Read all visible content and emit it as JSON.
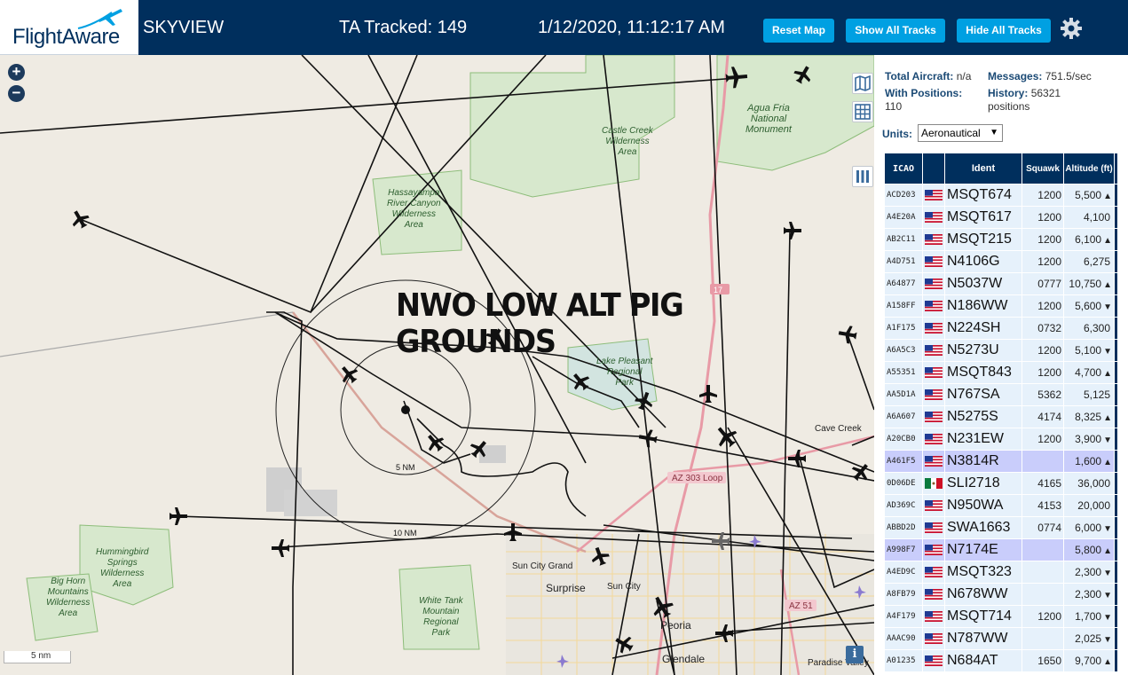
{
  "header": {
    "logo_text": "FlightAware",
    "app_name": "SKYVIEW",
    "tracked": "TA Tracked: 149",
    "timestamp": "1/12/2020, 11:12:17 AM",
    "buttons": {
      "reset": "Reset Map",
      "show": "Show All Tracks",
      "hide": "Hide All Tracks"
    },
    "settings_icon": "gear-icon"
  },
  "map": {
    "zoom_in": "+",
    "zoom_out": "−",
    "banner": "NWO LOW ALT PIG GROUNDS",
    "scale_label": "5 nm",
    "info_label": "i",
    "range_ring_labels": [
      "5 NM",
      "10 NM"
    ],
    "highway_label": "17",
    "route_label": "AZ 303 Loop",
    "route_label_2": "AZ 51",
    "regions": [
      {
        "text": "Agua Fria\nNational\nMonument"
      },
      {
        "text": "Castle Creek\nWilderness\nArea"
      },
      {
        "text": "Hassayampa\nRiver Canyon\nWilderness\nArea"
      },
      {
        "text": "Lake Pleasant\nRegional\nPark"
      },
      {
        "text": "Hummingbird\nSprings\nWilderness\nArea"
      },
      {
        "text": "Big Horn\nMountains\nWilderness\nArea"
      },
      {
        "text": "White Tank\nMountain\nRegional\nPark"
      }
    ],
    "cities": [
      "Cave Creek",
      "Sun City Grand",
      "Surprise",
      "Sun City",
      "Peoria",
      "Glendale",
      "Paradise Valley"
    ]
  },
  "sidebar": {
    "total_aircraft_label": "Total Aircraft:",
    "total_aircraft_value": "n/a",
    "messages_label": "Messages:",
    "messages_value": "751.5/sec",
    "positions_label": "With Positions:",
    "positions_value": "110",
    "history_label": "History:",
    "history_value": "56321 positions",
    "units_label": "Units:",
    "units_value": "Aeronautical",
    "columns": [
      "ICAO",
      "",
      "Ident",
      "Squawk",
      "Altitude (ft)"
    ],
    "rows": [
      {
        "icao": "ACD203",
        "flag": "us",
        "ident": "MSQT674",
        "squawk": "1200",
        "alt": "5,500",
        "trend": "▲",
        "selected": false
      },
      {
        "icao": "A4E20A",
        "flag": "us",
        "ident": "MSQT617",
        "squawk": "1200",
        "alt": "4,100",
        "trend": "",
        "selected": false
      },
      {
        "icao": "AB2C11",
        "flag": "us",
        "ident": "MSQT215",
        "squawk": "1200",
        "alt": "6,100",
        "trend": "▲",
        "selected": false
      },
      {
        "icao": "A4D751",
        "flag": "us",
        "ident": "N4106G",
        "squawk": "1200",
        "alt": "6,275",
        "trend": "",
        "selected": false
      },
      {
        "icao": "A64877",
        "flag": "us",
        "ident": "N5037W",
        "squawk": "0777",
        "alt": "10,750",
        "trend": "▲",
        "selected": false
      },
      {
        "icao": "A158FF",
        "flag": "us",
        "ident": "N186WW",
        "squawk": "1200",
        "alt": "5,600",
        "trend": "▼",
        "selected": false
      },
      {
        "icao": "A1F175",
        "flag": "us",
        "ident": "N224SH",
        "squawk": "0732",
        "alt": "6,300",
        "trend": "",
        "selected": false
      },
      {
        "icao": "A6A5C3",
        "flag": "us",
        "ident": "N5273U",
        "squawk": "1200",
        "alt": "5,100",
        "trend": "▼",
        "selected": false
      },
      {
        "icao": "A55351",
        "flag": "us",
        "ident": "MSQT843",
        "squawk": "1200",
        "alt": "4,700",
        "trend": "▲",
        "selected": false
      },
      {
        "icao": "AA5D1A",
        "flag": "us",
        "ident": "N767SA",
        "squawk": "5362",
        "alt": "5,125",
        "trend": "",
        "selected": false
      },
      {
        "icao": "A6A607",
        "flag": "us",
        "ident": "N5275S",
        "squawk": "4174",
        "alt": "8,325",
        "trend": "▲",
        "selected": false
      },
      {
        "icao": "A20CB0",
        "flag": "us",
        "ident": "N231EW",
        "squawk": "1200",
        "alt": "3,900",
        "trend": "▼",
        "selected": false
      },
      {
        "icao": "A461F5",
        "flag": "us",
        "ident": "N3814R",
        "squawk": "",
        "alt": "1,600",
        "trend": "▲",
        "selected": true
      },
      {
        "icao": "0D06DE",
        "flag": "mx",
        "ident": "SLI2718",
        "squawk": "4165",
        "alt": "36,000",
        "trend": "",
        "selected": false
      },
      {
        "icao": "AD369C",
        "flag": "us",
        "ident": "N950WA",
        "squawk": "4153",
        "alt": "20,000",
        "trend": "",
        "selected": false
      },
      {
        "icao": "ABBD2D",
        "flag": "us",
        "ident": "SWA1663",
        "squawk": "0774",
        "alt": "6,000",
        "trend": "▼",
        "selected": false
      },
      {
        "icao": "A998F7",
        "flag": "us",
        "ident": "N7174E",
        "squawk": "",
        "alt": "5,800",
        "trend": "▲",
        "selected": true
      },
      {
        "icao": "A4ED9C",
        "flag": "us",
        "ident": "MSQT323",
        "squawk": "",
        "alt": "2,300",
        "trend": "▼",
        "selected": false
      },
      {
        "icao": "A8FB79",
        "flag": "us",
        "ident": "N678WW",
        "squawk": "",
        "alt": "2,300",
        "trend": "▼",
        "selected": false
      },
      {
        "icao": "A4F179",
        "flag": "us",
        "ident": "MSQT714",
        "squawk": "1200",
        "alt": "1,700",
        "trend": "▼",
        "selected": false
      },
      {
        "icao": "AAAC90",
        "flag": "us",
        "ident": "N787WW",
        "squawk": "",
        "alt": "2,025",
        "trend": "▼",
        "selected": false
      },
      {
        "icao": "A01235",
        "flag": "us",
        "ident": "N684AT",
        "squawk": "1650",
        "alt": "9,700",
        "trend": "▲",
        "selected": false
      }
    ]
  },
  "colors": {
    "header_bg": "#002F5D",
    "button_bg": "#00A0E2",
    "row_bg": "#E6F1FB",
    "row_selected": "#C9CDFB"
  }
}
